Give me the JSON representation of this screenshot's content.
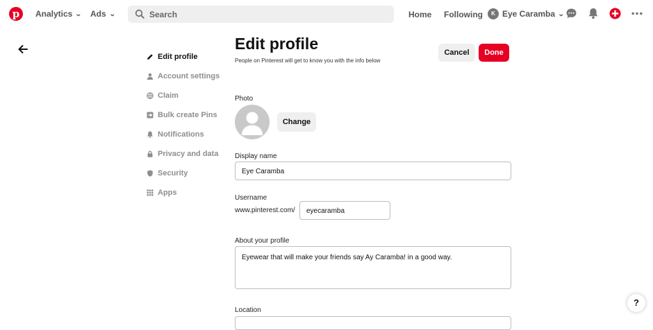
{
  "topbar": {
    "analytics_label": "Analytics",
    "ads_label": "Ads",
    "search_placeholder": "Search",
    "home_label": "Home",
    "following_label": "Following",
    "avatar_initial": "K",
    "username": "Eye Caramba",
    "icons": [
      "pinterest-logo",
      "search-icon",
      "chat-icon",
      "bell-icon",
      "plus-icon",
      "more-icon"
    ],
    "brand_color": "#e60023"
  },
  "sidebar": {
    "items": [
      {
        "label": "Edit profile",
        "icon": "pencil-icon",
        "active": true
      },
      {
        "label": "Account settings",
        "icon": "person-icon",
        "active": false
      },
      {
        "label": "Claim",
        "icon": "globe-icon",
        "active": false
      },
      {
        "label": "Bulk create Pins",
        "icon": "import-icon",
        "active": false
      },
      {
        "label": "Notifications",
        "icon": "bell-icon",
        "active": false
      },
      {
        "label": "Privacy and data",
        "icon": "lock-icon",
        "active": false
      },
      {
        "label": "Security",
        "icon": "shield-icon",
        "active": false
      },
      {
        "label": "Apps",
        "icon": "grid-icon",
        "active": false
      }
    ]
  },
  "main": {
    "title": "Edit profile",
    "subtitle": "People on Pinterest will get to know you with the info below",
    "cancel_label": "Cancel",
    "done_label": "Done",
    "photo_label": "Photo",
    "change_label": "Change",
    "display_name_label": "Display name",
    "display_name_value": "Eye Caramba",
    "username_label": "Username",
    "username_prefix": "www.pinterest.com/",
    "username_value": "eyecaramba",
    "about_label": "About your profile",
    "about_value": "Eyewear that will make your friends say Ay Caramba! in a good way.",
    "location_label": "Location"
  },
  "help_label": "?"
}
